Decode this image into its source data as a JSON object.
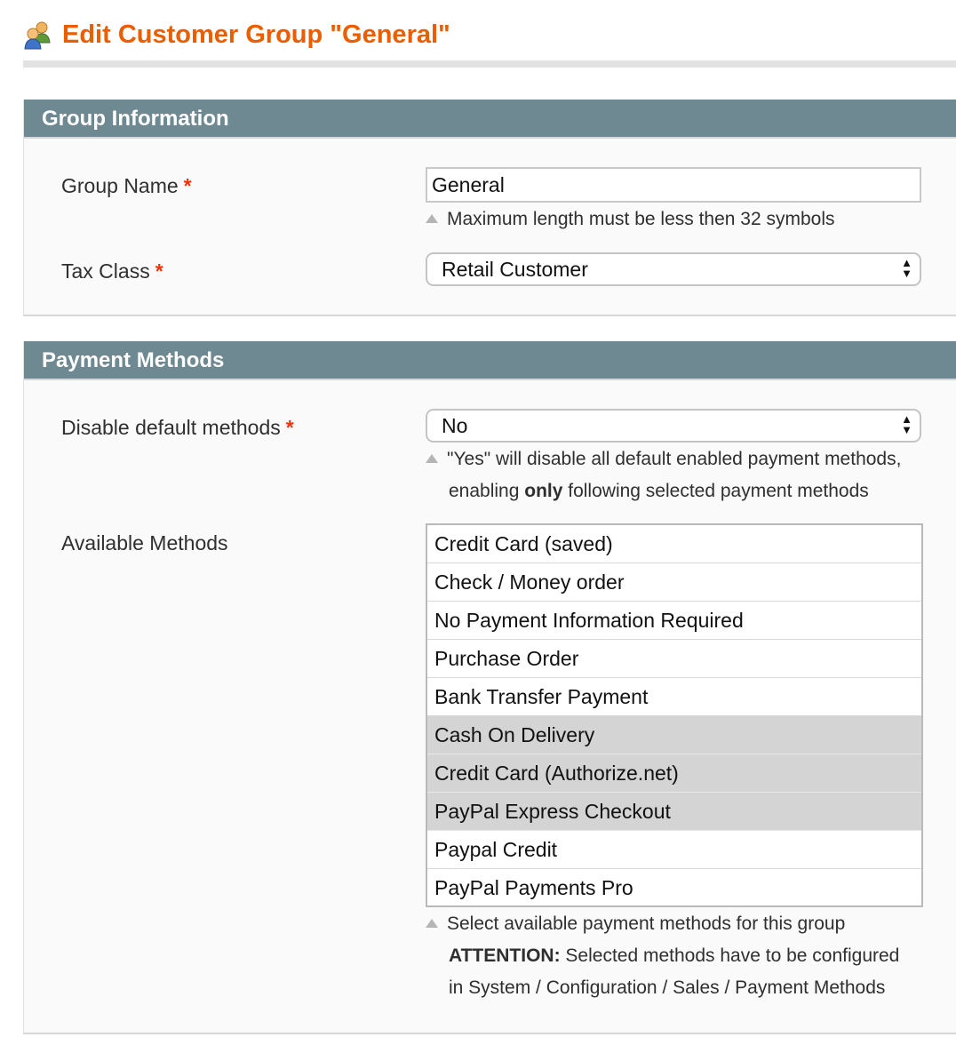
{
  "page": {
    "title": "Edit Customer Group \"General\"",
    "icon": "customer-group-icon"
  },
  "group_information": {
    "header": "Group Information",
    "group_name": {
      "label": "Group Name",
      "required_mark": "*",
      "value": "General",
      "note": "Maximum length must be less then 32 symbols"
    },
    "tax_class": {
      "label": "Tax Class",
      "required_mark": "*",
      "selected": "Retail Customer"
    }
  },
  "payment_methods": {
    "header": "Payment Methods",
    "disable_default": {
      "label": "Disable default methods",
      "required_mark": "*",
      "selected": "No",
      "note_line1": "\"Yes\" will disable all default enabled payment methods,",
      "note_line2_pre": "enabling ",
      "note_line2_bold": "only",
      "note_line2_post": " following selected payment methods"
    },
    "available": {
      "label": "Available Methods",
      "options": [
        {
          "label": "Credit Card (saved)",
          "selected": false
        },
        {
          "label": "Check / Money order",
          "selected": false
        },
        {
          "label": "No Payment Information Required",
          "selected": false
        },
        {
          "label": "Purchase Order",
          "selected": false
        },
        {
          "label": "Bank Transfer Payment",
          "selected": false
        },
        {
          "label": "Cash On Delivery",
          "selected": true
        },
        {
          "label": "Credit Card (Authorize.net)",
          "selected": true
        },
        {
          "label": "PayPal Express Checkout",
          "selected": true
        },
        {
          "label": "Paypal Credit",
          "selected": false
        },
        {
          "label": "PayPal Payments Pro",
          "selected": false
        }
      ],
      "note_line1": "Select available payment methods for this group",
      "note_line2_bold": "ATTENTION:",
      "note_line2_post": " Selected methods have to be configured",
      "note_line3": "in System / Configuration / Sales / Payment Methods"
    }
  },
  "colors": {
    "title": "#eb5e00",
    "section_header_bg": "#6f8992",
    "required": "#eb340a",
    "selected_option_bg": "#d4d4d4"
  }
}
